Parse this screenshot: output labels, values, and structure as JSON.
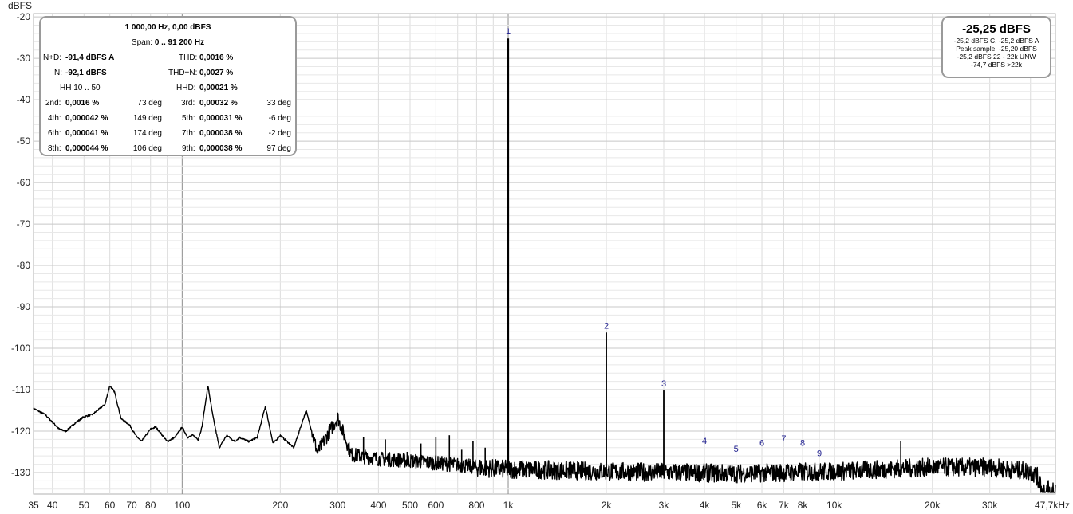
{
  "chart_data": {
    "type": "line",
    "ylabel": "dBFS",
    "x_scale": "log",
    "xlim": [
      35,
      47700
    ],
    "ylim": [
      -135,
      -20
    ],
    "y_ticks": [
      -20,
      -30,
      -40,
      -50,
      -60,
      -70,
      -80,
      -90,
      -100,
      -110,
      -120,
      -130
    ],
    "x_ticks": [
      {
        "v": 35,
        "label": "35"
      },
      {
        "v": 40,
        "label": "40"
      },
      {
        "v": 50,
        "label": "50"
      },
      {
        "v": 60,
        "label": "60"
      },
      {
        "v": 70,
        "label": "70"
      },
      {
        "v": 80,
        "label": "80"
      },
      {
        "v": 100,
        "label": "100"
      },
      {
        "v": 200,
        "label": "200"
      },
      {
        "v": 300,
        "label": "300"
      },
      {
        "v": 400,
        "label": "400"
      },
      {
        "v": 500,
        "label": "500"
      },
      {
        "v": 600,
        "label": "600"
      },
      {
        "v": 800,
        "label": "800"
      },
      {
        "v": 1000,
        "label": "1k"
      },
      {
        "v": 2000,
        "label": "2k"
      },
      {
        "v": 3000,
        "label": "3k"
      },
      {
        "v": 4000,
        "label": "4k"
      },
      {
        "v": 5000,
        "label": "5k"
      },
      {
        "v": 6000,
        "label": "6k"
      },
      {
        "v": 7000,
        "label": "7k"
      },
      {
        "v": 8000,
        "label": "8k"
      },
      {
        "v": 10000,
        "label": "10k"
      },
      {
        "v": 20000,
        "label": "20k"
      },
      {
        "v": 30000,
        "label": "30k"
      },
      {
        "v": 47700,
        "label": "47,7kHz"
      }
    ],
    "grid": true,
    "noise_floor": [
      [
        35,
        -114.5
      ],
      [
        38,
        -116
      ],
      [
        42,
        -119.5
      ],
      [
        44,
        -120
      ],
      [
        47,
        -118
      ],
      [
        50,
        -116.5
      ],
      [
        53,
        -116
      ],
      [
        56,
        -114.5
      ],
      [
        58,
        -113.5
      ],
      [
        60,
        -109
      ],
      [
        62,
        -110.5
      ],
      [
        65,
        -117
      ],
      [
        69,
        -118.5
      ],
      [
        72,
        -121
      ],
      [
        75,
        -122.5
      ],
      [
        80,
        -119.5
      ],
      [
        83,
        -119
      ],
      [
        86,
        -120.5
      ],
      [
        90,
        -122.5
      ],
      [
        95,
        -121.5
      ],
      [
        100,
        -119
      ],
      [
        104,
        -121.5
      ],
      [
        108,
        -121
      ],
      [
        112,
        -122
      ],
      [
        115,
        -119
      ],
      [
        120,
        -109
      ],
      [
        124,
        -116
      ],
      [
        130,
        -124
      ],
      [
        137,
        -121
      ],
      [
        145,
        -122.5
      ],
      [
        150,
        -121.5
      ],
      [
        160,
        -122.5
      ],
      [
        170,
        -121.5
      ],
      [
        180,
        -114
      ],
      [
        190,
        -123
      ],
      [
        200,
        -121
      ],
      [
        220,
        -124
      ],
      [
        240,
        -115
      ],
      [
        260,
        -125
      ],
      [
        300,
        -116.5
      ],
      [
        330,
        -125.5
      ],
      [
        400,
        -126.5
      ],
      [
        500,
        -127
      ],
      [
        600,
        -127.5
      ],
      [
        700,
        -128
      ],
      [
        800,
        -128.5
      ],
      [
        980,
        -129
      ],
      [
        1100,
        -129
      ],
      [
        2000,
        -129.5
      ],
      [
        5000,
        -130
      ],
      [
        10000,
        -129.5
      ],
      [
        20000,
        -128.5
      ],
      [
        30000,
        -128.5
      ],
      [
        40000,
        -129.5
      ],
      [
        44000,
        -132
      ],
      [
        47700,
        -133
      ]
    ],
    "spurs": [
      [
        180,
        -114
      ],
      [
        240,
        -115
      ],
      [
        300,
        -116.5
      ],
      [
        360,
        -121.5
      ],
      [
        420,
        -122
      ],
      [
        490,
        -125
      ],
      [
        540,
        -123
      ],
      [
        600,
        -121.5
      ],
      [
        660,
        -121
      ],
      [
        720,
        -124.5
      ],
      [
        780,
        -122.5
      ],
      [
        850,
        -124
      ],
      [
        16000,
        -122.5
      ]
    ],
    "harmonics": [
      {
        "label": "1",
        "freq": 1000,
        "level": -25.2
      },
      {
        "label": "2",
        "freq": 2000,
        "level": -96.2
      },
      {
        "label": "3",
        "freq": 3000,
        "level": -110.2
      },
      {
        "label": "4",
        "freq": 4000,
        "level": -124
      },
      {
        "label": "5",
        "freq": 5000,
        "level": -126
      },
      {
        "label": "6",
        "freq": 6000,
        "level": -124.5
      },
      {
        "label": "7",
        "freq": 7000,
        "level": -123.5
      },
      {
        "label": "8",
        "freq": 8000,
        "level": -124.5
      },
      {
        "label": "9",
        "freq": 9000,
        "level": -127
      }
    ]
  },
  "info_box": {
    "title": "1 000,00 Hz, 0,00 dBFS",
    "span_label": "Span:",
    "span_value": "0 .. 91 200 Hz",
    "nd_label": "N+D:",
    "nd_value": "-91,4 dBFS A",
    "thd_label": "THD:",
    "thd_value": "0,0016 %",
    "n_label": "N:",
    "n_value": "-92,1 dBFS",
    "thdn_label": "THD+N:",
    "thdn_value": "0,0027 %",
    "hh_label": "HH 10 .. 50",
    "hhd_label": "HHD:",
    "hhd_value": "0,00021 %",
    "harmonics": [
      {
        "label": "2nd:",
        "pct": "0,0016 %",
        "deg": "73 deg"
      },
      {
        "label": "3rd:",
        "pct": "0,00032 %",
        "deg": "33 deg"
      },
      {
        "label": "4th:",
        "pct": "0,000042 %",
        "deg": "149 deg"
      },
      {
        "label": "5th:",
        "pct": "0,000031 %",
        "deg": "-6 deg"
      },
      {
        "label": "6th:",
        "pct": "0,000041 %",
        "deg": "174 deg"
      },
      {
        "label": "7th:",
        "pct": "0,000038 %",
        "deg": "-2 deg"
      },
      {
        "label": "8th:",
        "pct": "0,000044 %",
        "deg": "106 deg"
      },
      {
        "label": "9th:",
        "pct": "0,000038 %",
        "deg": "97 deg"
      }
    ]
  },
  "level_box": {
    "main": "-25,25 dBFS",
    "lines": [
      "-25,2 dBFS C, -25,2 dBFS A",
      "Peak sample: -25,20 dBFS",
      "-25,2 dBFS 22 - 22k UNW",
      "-74,7 dBFS >22k"
    ]
  },
  "colors": {
    "background": "#ffffff",
    "trace": "#000000",
    "grid_minor": "#dcdcdc",
    "grid_major": "#8c8c8c",
    "harmonic_label": "#1a1a8c",
    "box_border": "#9a9a9a"
  }
}
